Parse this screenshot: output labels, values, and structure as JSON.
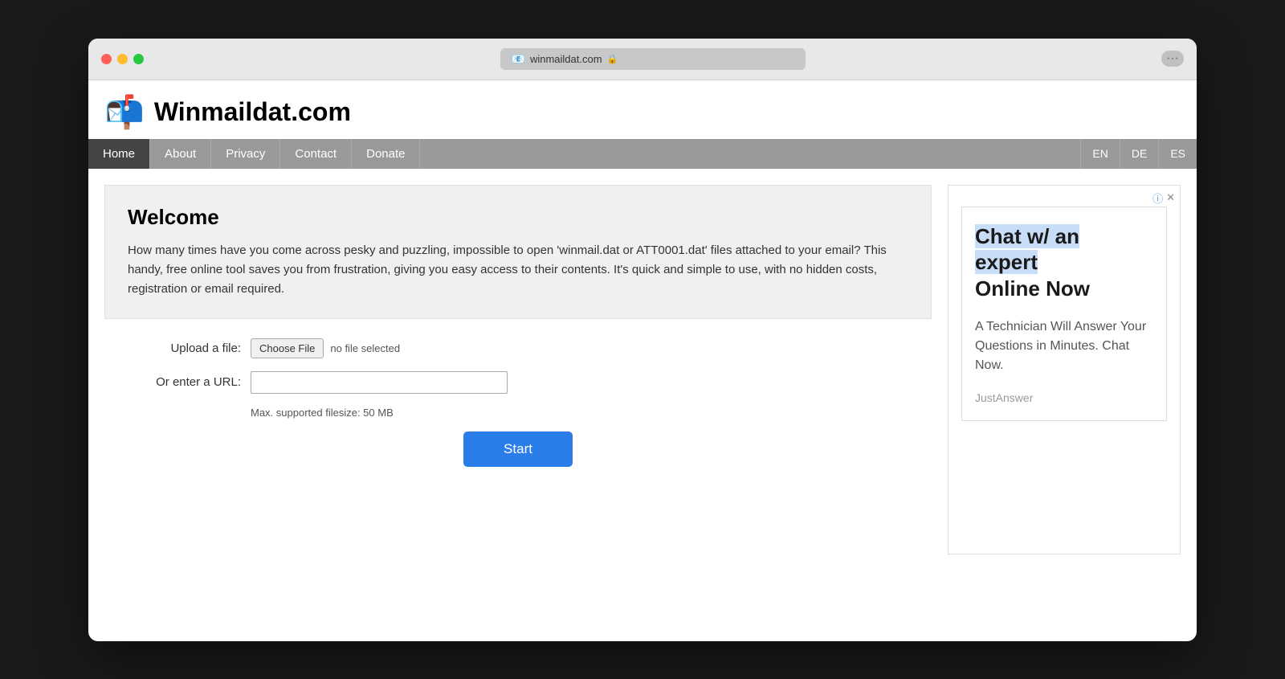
{
  "browser": {
    "address": "winmaildat.com",
    "lock_icon": "🔒",
    "favicon": "📧",
    "more_icon": "···"
  },
  "site": {
    "title": "Winmaildat.com",
    "logo_emoji": "📬"
  },
  "nav": {
    "items": [
      {
        "label": "Home",
        "active": true
      },
      {
        "label": "About"
      },
      {
        "label": "Privacy"
      },
      {
        "label": "Contact"
      },
      {
        "label": "Donate"
      }
    ],
    "languages": [
      {
        "code": "EN"
      },
      {
        "code": "DE"
      },
      {
        "code": "ES"
      }
    ]
  },
  "welcome": {
    "title": "Welcome",
    "text": "How many times have you come across pesky and puzzling, impossible to open 'winmail.dat or ATT0001.dat' files attached to your email? This handy, free online tool saves you from frustration, giving you easy access to their contents. It's quick and simple to use, with no hidden costs, registration or email required."
  },
  "form": {
    "upload_label": "Upload a file:",
    "choose_file_btn": "Choose File",
    "no_file_text": "no file selected",
    "url_label": "Or enter a URL:",
    "url_placeholder": "",
    "max_filesize": "Max. supported filesize: 50 MB",
    "start_btn": "Start"
  },
  "ad": {
    "headline_part1": "Chat w/ an",
    "headline_part2": "expert",
    "headline_part3": "Online Now",
    "highlight_words": "Chat w/ an expert",
    "subtext": "A Technician Will Answer Your Questions in Minutes. Chat Now.",
    "brand": "JustAnswer"
  }
}
